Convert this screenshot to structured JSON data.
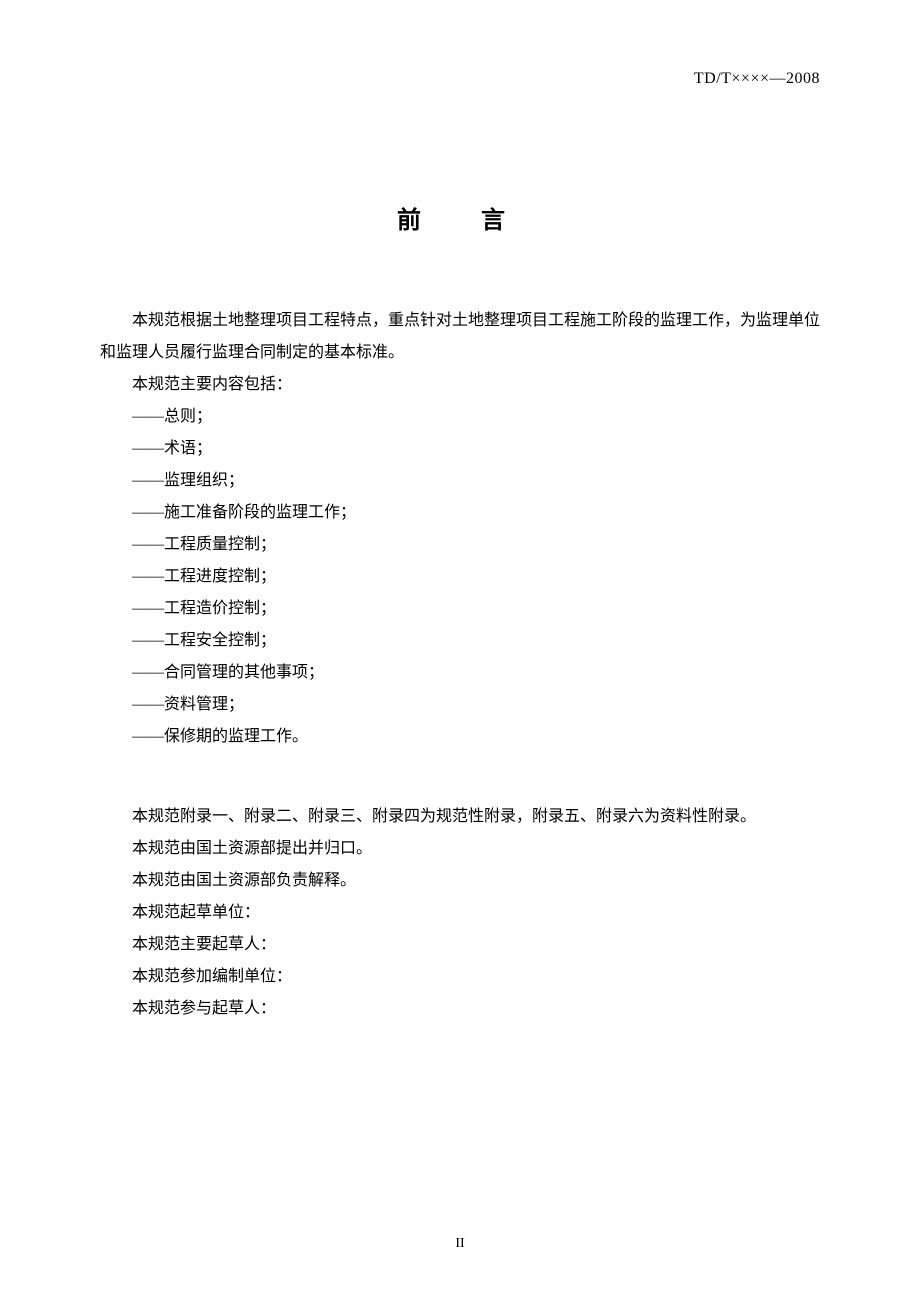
{
  "header": {
    "doc_code": "TD/T××××—2008"
  },
  "title": "前　言",
  "intro": {
    "p1": "本规范根据土地整理项目工程特点，重点针对土地整理项目工程施工阶段的监理工作，为监理单位和监理人员履行监理合同制定的基本标准。",
    "p2": "本规范主要内容包括："
  },
  "contents_list": [
    "——总则；",
    "——术语；",
    "——监理组织；",
    "——施工准备阶段的监理工作；",
    "——工程质量控制；",
    "——工程进度控制；",
    "——工程造价控制；",
    "——工程安全控制；",
    "——合同管理的其他事项；",
    "——资料管理；",
    "——保修期的监理工作。"
  ],
  "notes": [
    "本规范附录一、附录二、附录三、附录四为规范性附录，附录五、附录六为资料性附录。",
    "本规范由国土资源部提出并归口。",
    "本规范由国土资源部负责解释。",
    "本规范起草单位：",
    "本规范主要起草人：",
    "本规范参加编制单位：",
    "本规范参与起草人："
  ],
  "page_number": "II"
}
